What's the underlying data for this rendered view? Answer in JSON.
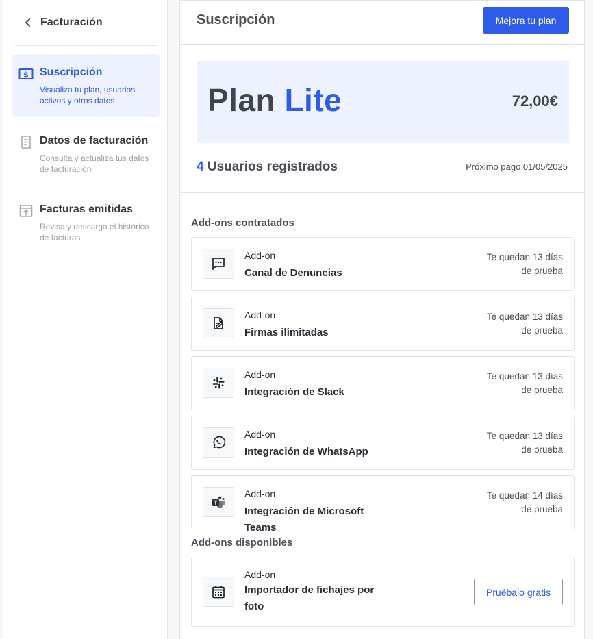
{
  "sidebar": {
    "back_title": "Facturación",
    "items": [
      {
        "title": "Suscripción",
        "desc": "Visualiza tu plan, usuarios activos y otros datos"
      },
      {
        "title": "Datos de facturación",
        "desc": "Consulta y actualiza tus datos de facturación"
      },
      {
        "title": "Facturas emitidas",
        "desc": "Revisa y descarga el histórico de facturas"
      }
    ]
  },
  "header": {
    "title": "Suscripción",
    "upgrade_label": "Mejora tu plan"
  },
  "plan": {
    "prefix": "Plan",
    "name": "Lite",
    "price": "72,00€",
    "users_count": "4",
    "users_label": "Usuarios registrados",
    "next_payment": "Próximo pago 01/05/2025"
  },
  "contracted": {
    "title": "Add-ons contratados",
    "items": [
      {
        "kicker": "Add-on",
        "name": "Canal de Denuncias",
        "trial_line1": "Te quedan 13 días",
        "trial_line2": "de prueba",
        "icon": "chat-icon"
      },
      {
        "kicker": "Add-on",
        "name": "Firmas ilimitadas",
        "trial_line1": "Te quedan 13 días",
        "trial_line2": "de prueba",
        "icon": "signature-icon"
      },
      {
        "kicker": "Add-on",
        "name": "Integración de Slack",
        "trial_line1": "Te quedan 13 días",
        "trial_line2": "de prueba",
        "icon": "slack-icon"
      },
      {
        "kicker": "Add-on",
        "name": "Integración de WhatsApp",
        "trial_line1": "Te quedan 13 días",
        "trial_line2": "de prueba",
        "icon": "whatsapp-icon"
      },
      {
        "kicker": "Add-on",
        "name": "Integración de Microsoft Teams",
        "trial_line1": "Te quedan 14 días",
        "trial_line2": "de prueba",
        "icon": "teams-icon"
      }
    ]
  },
  "available": {
    "title": "Add-ons disponibles",
    "items": [
      {
        "kicker": "Add-on",
        "name": "Importador de fichajes por foto",
        "cta": "Pruébalo gratis",
        "icon": "calendar-icon"
      }
    ]
  },
  "colors": {
    "accent": "#2f5bea",
    "active_bg": "#eef2ff"
  }
}
